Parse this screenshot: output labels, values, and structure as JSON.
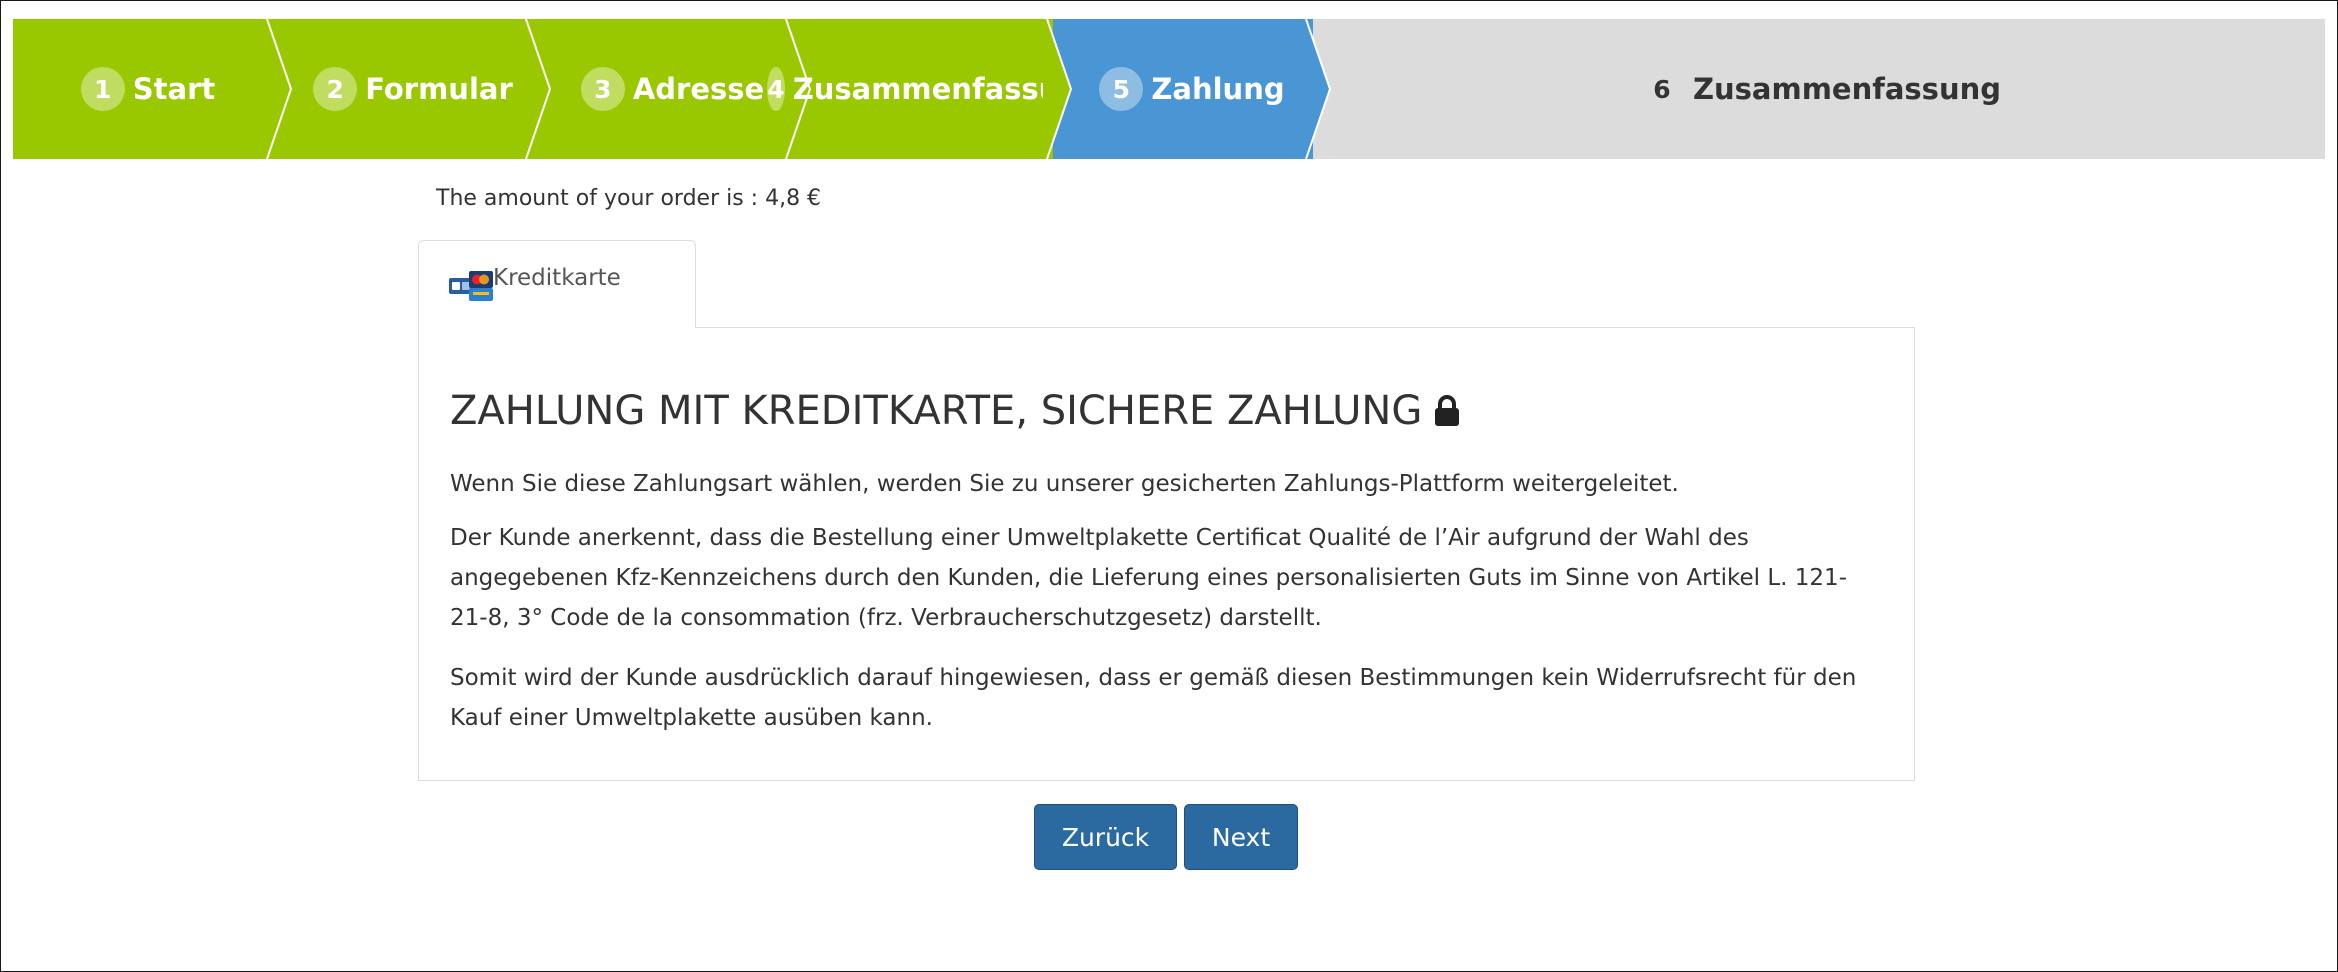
{
  "steps": [
    {
      "number": "1",
      "label": "Start",
      "state": "done"
    },
    {
      "number": "2",
      "label": "Formular",
      "state": "done"
    },
    {
      "number": "3",
      "label": "Adresse",
      "state": "done"
    },
    {
      "number": "4",
      "label": "Zusammenfassung",
      "state": "done"
    },
    {
      "number": "5",
      "label": "Zahlung",
      "state": "active"
    },
    {
      "number": "6",
      "label": "Zusammenfassung",
      "state": "future"
    }
  ],
  "colors": {
    "done": "#99c700",
    "active": "#4a95d4",
    "future": "#dcdcdc",
    "button": "#2b6aa0"
  },
  "order_amount_text": "The amount of your order is : 4,8 €",
  "tab": {
    "label": "Kreditkarte",
    "icon": "credit-card-icon"
  },
  "panel": {
    "title": "ZAHLUNG MIT KREDITKARTE, SICHERE ZAHLUNG",
    "title_icon": "lock-icon",
    "p1": "Wenn Sie diese Zahlungsart wählen, werden Sie zu unserer gesicherten Zahlungs-Plattform weitergeleitet.",
    "p2": "Der Kunde anerkennt, dass die Bestellung einer Umweltplakette Certificat Qualité de l’Air aufgrund der Wahl des angegebenen Kfz-Kennzeichens durch den Kunden, die Lieferung eines personalisierten Guts im Sinne von Artikel L. 121-21-8, 3° Code de la consommation (frz. Verbraucherschutzgesetz) darstellt.",
    "p3": "Somit wird der Kunde ausdrücklich darauf hingewiesen, dass er gemäß diesen Bestimmungen kein Widerrufsrecht für den Kauf einer Umweltplakette ausüben kann."
  },
  "buttons": {
    "back": "Zurück",
    "next": "Next"
  }
}
